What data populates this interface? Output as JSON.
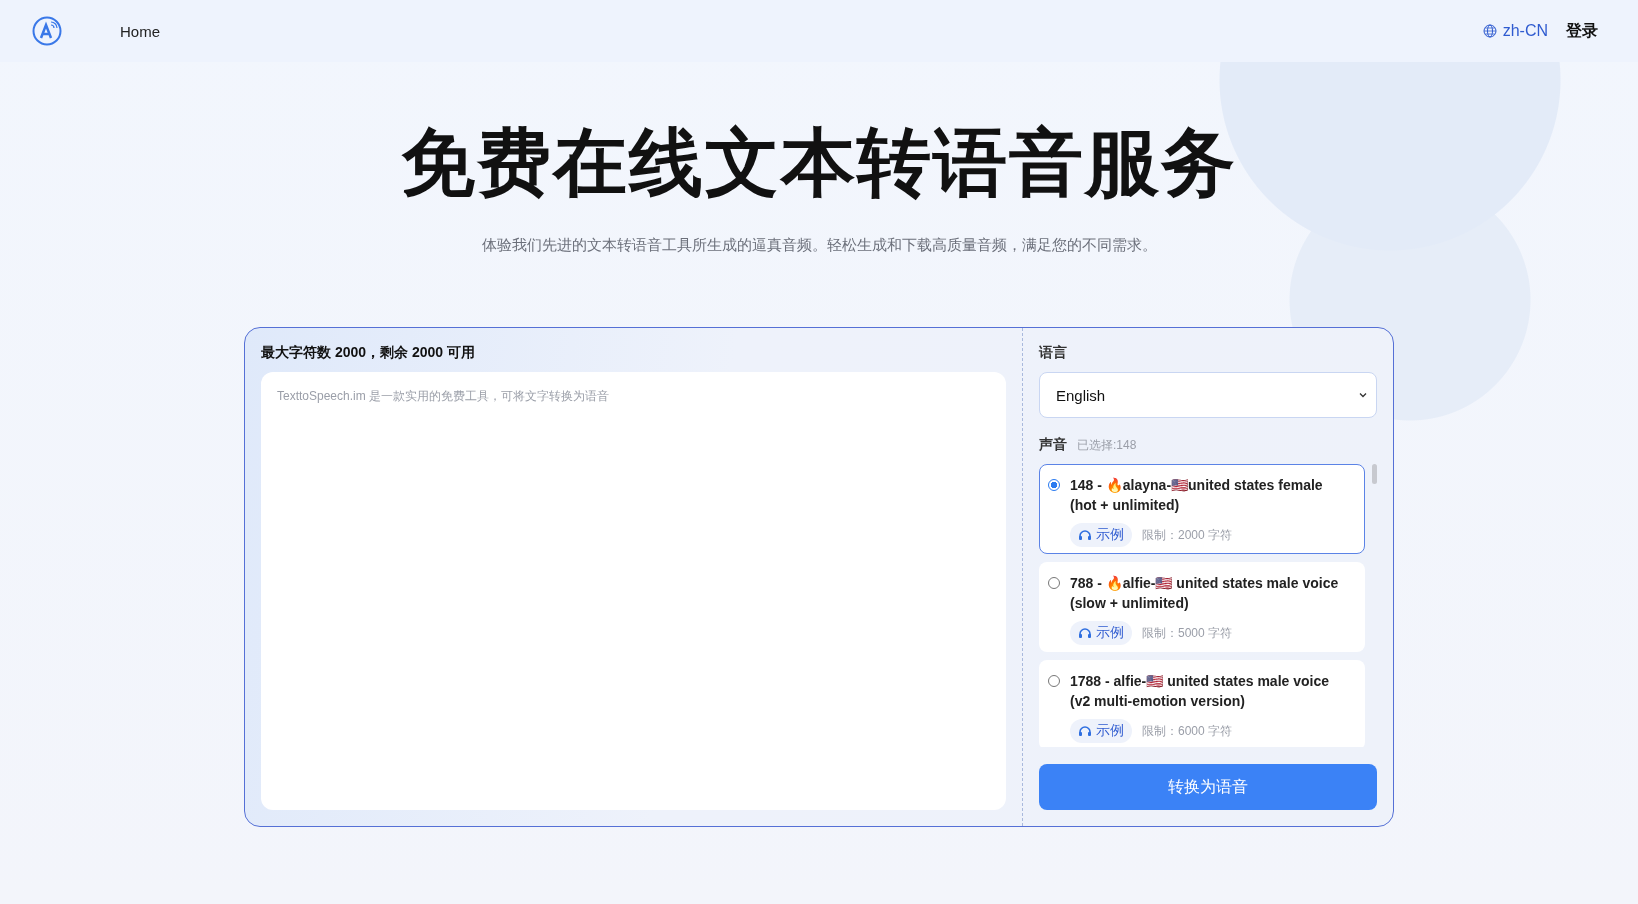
{
  "header": {
    "nav": [
      {
        "label": "Home"
      }
    ],
    "language": "zh-CN",
    "login": "登录"
  },
  "hero": {
    "title": "免费在线文本转语音服务",
    "subtitle": "体验我们先进的文本转语音工具所生成的逼真音频。轻松生成和下载高质量音频，满足您的不同需求。"
  },
  "editor": {
    "counter": "最大字符数 2000，剩余 2000 可用",
    "placeholder": "TexttoSpeech.im 是一款实用的免费工具，可将文字转换为语音"
  },
  "settings": {
    "language_label": "语言",
    "language_value": "English",
    "voice_label": "声音",
    "voice_selected": "已选择:148",
    "voices": [
      {
        "name": "148 - 🔥alayna-🇺🇸united states female (hot + unlimited)",
        "sample": "示例",
        "limit": "限制：2000 字符",
        "selected": true
      },
      {
        "name": "788 - 🔥alfie-🇺🇸 united states male voice (slow + unlimited)",
        "sample": "示例",
        "limit": "限制：5000 字符",
        "selected": false
      },
      {
        "name": "1788 - alfie-🇺🇸 united states male voice (v2 multi-emotion version)",
        "sample": "示例",
        "limit": "限制：6000 字符",
        "selected": false
      }
    ],
    "convert_button": "转换为语音"
  }
}
